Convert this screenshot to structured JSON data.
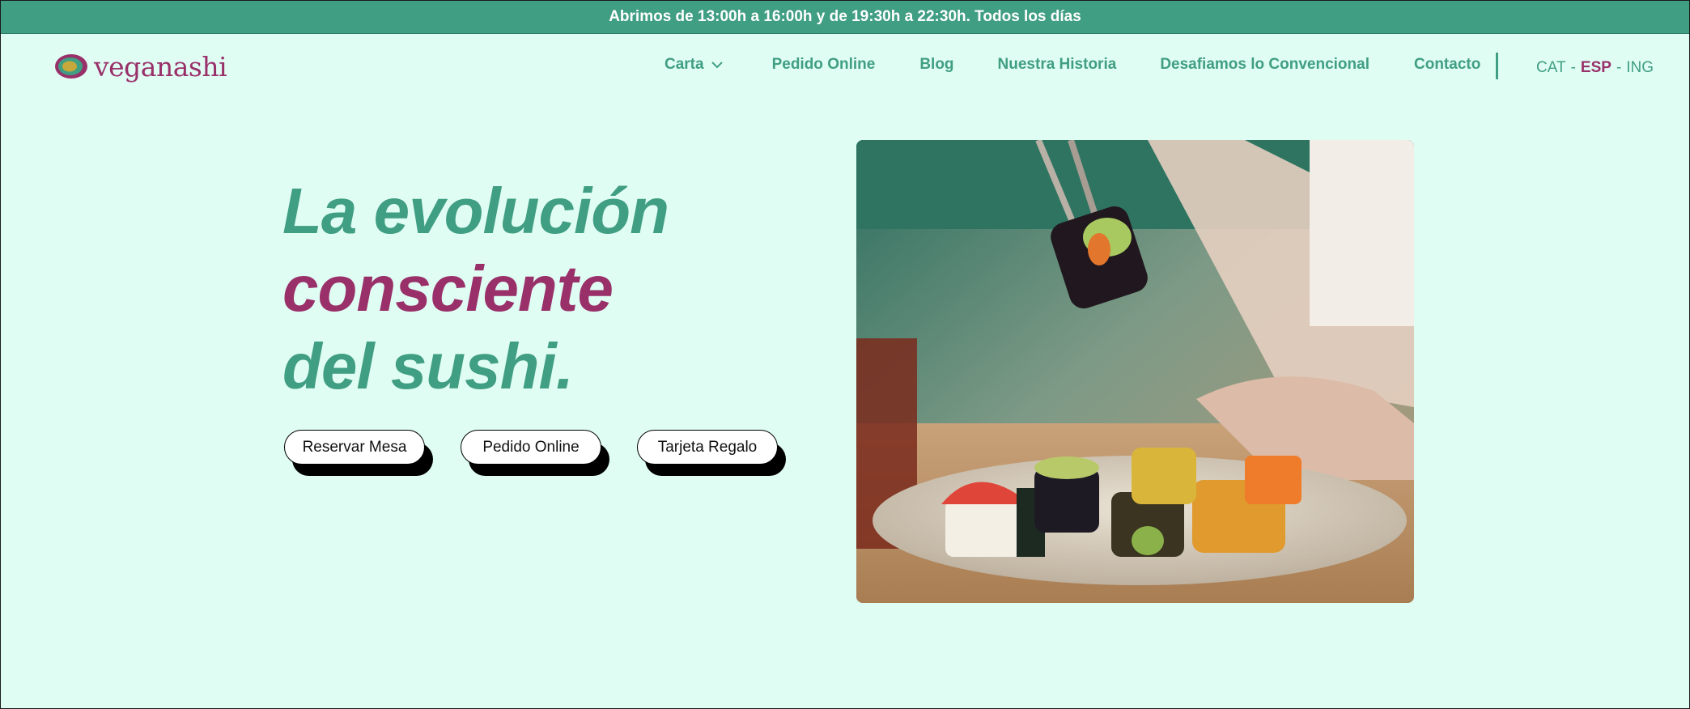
{
  "announcement": "Abrimos de 13:00h a 16:00h y de 19:30h a 22:30h. Todos los días",
  "brand": {
    "name": "veganashi"
  },
  "nav": {
    "items": [
      {
        "label": "Carta",
        "icon": "chevron-down-icon"
      },
      {
        "label": "Pedido Online"
      },
      {
        "label": "Blog"
      },
      {
        "label": "Nuestra Historia"
      },
      {
        "label": "Desafiamos lo Convencional"
      },
      {
        "label": "Contacto"
      }
    ]
  },
  "languages": {
    "cat": "CAT",
    "esp": "ESP",
    "ing": "ING",
    "separator": "-",
    "active": "ESP"
  },
  "hero": {
    "line1": "La evolución",
    "line2": "consciente",
    "line3": "del sushi.",
    "buttons": {
      "reservar": "Reservar Mesa",
      "pedido": "Pedido Online",
      "tarjeta": "Tarjeta Regalo"
    }
  },
  "colors": {
    "green": "#409e82",
    "magenta": "#993069",
    "background": "#e0fdf4"
  }
}
